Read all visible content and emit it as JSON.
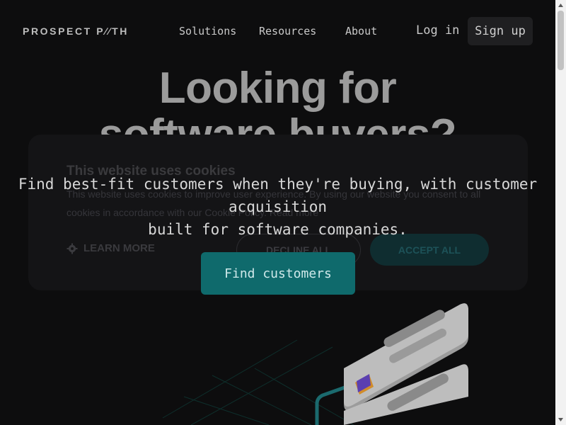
{
  "header": {
    "logo": "PROSPECT P∕∕TH",
    "nav": [
      "Solutions",
      "Resources",
      "About"
    ],
    "login": "Log in",
    "signup": "Sign up"
  },
  "hero": {
    "headline_line1": "Looking for",
    "headline_line2": "software buyers?",
    "subhead_line1": "Find best-fit customers when they're buying, with customer acquisition",
    "subhead_line2": "built for software companies.",
    "cta": "Find customers"
  },
  "cookie_banner": {
    "title": "This website uses cookies",
    "body": "This website uses cookies to improve user experience. By using our website you consent to all cookies in accordance with our Cookie Policy. Read more",
    "learn_more": "LEARN MORE",
    "decline": "DECLINE ALL",
    "accept": "ACCEPT ALL",
    "learn_more_icon": "gear-icon"
  },
  "colors": {
    "background": "#0d0d0e",
    "accent": "#0f6a6c",
    "headline": "#9b9b9b"
  }
}
